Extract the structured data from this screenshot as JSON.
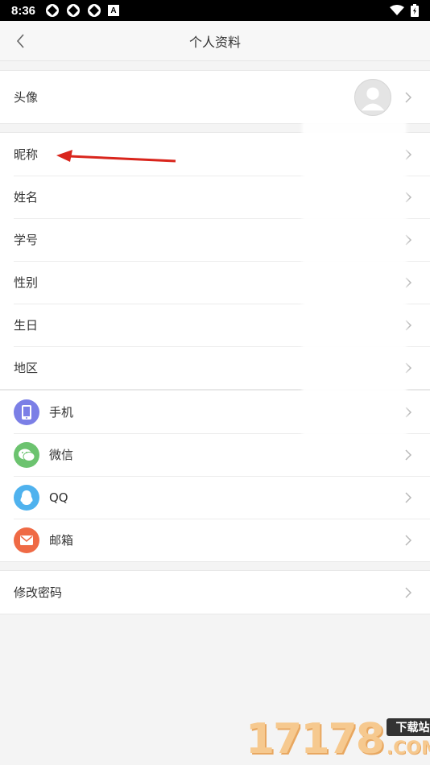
{
  "status_bar": {
    "time": "8:36",
    "indicator_letter": "A"
  },
  "header": {
    "title": "个人资料"
  },
  "profile": {
    "avatar_label": "头像"
  },
  "info_rows": [
    {
      "label": "昵称"
    },
    {
      "label": "姓名"
    },
    {
      "label": "学号"
    },
    {
      "label": "性别"
    },
    {
      "label": "生日"
    },
    {
      "label": "地区"
    }
  ],
  "account_rows": [
    {
      "label": "手机",
      "icon": "phone-icon",
      "color": "#7b7fe6"
    },
    {
      "label": "微信",
      "icon": "wechat-icon",
      "color": "#6cc36f"
    },
    {
      "label": "QQ",
      "icon": "qq-icon",
      "color": "#4fb2ee"
    },
    {
      "label": "邮箱",
      "icon": "mail-icon",
      "color": "#ef6a45"
    }
  ],
  "security": {
    "change_password_label": "修改密码"
  },
  "watermark": {
    "number": "17178",
    "tag": "下载站",
    "suffix": ".COM"
  }
}
